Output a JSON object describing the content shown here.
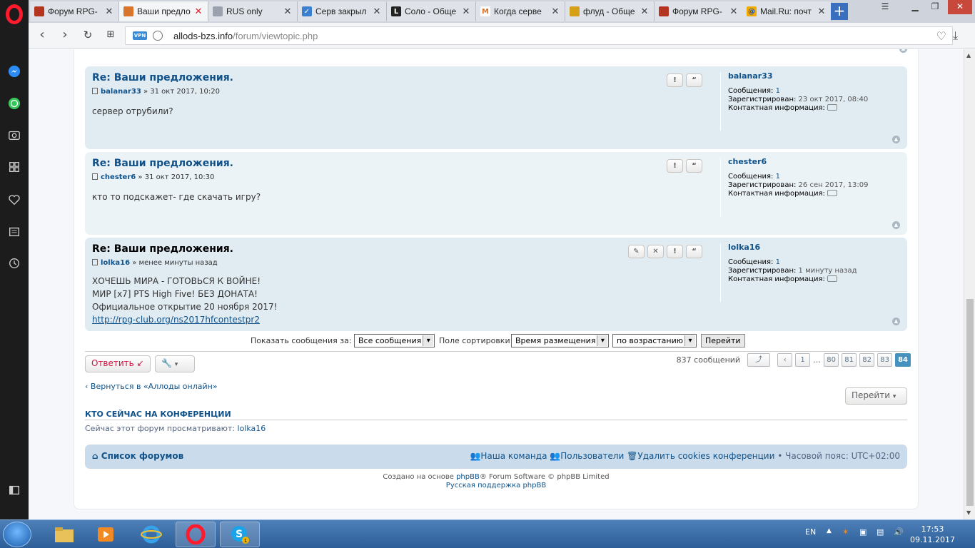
{
  "browser": {
    "tabs": [
      {
        "title": "Форум RPG-",
        "favicon_color": "#b5341f"
      },
      {
        "title": "Ваши предло",
        "favicon_color": "#d8742c",
        "active": true
      },
      {
        "title": "RUS only",
        "favicon_color": "#9aa3ad"
      },
      {
        "title": "Серв закрыл",
        "favicon_color": "#3a7fd0"
      },
      {
        "title": "Соло - Обще",
        "favicon_color": "#222222",
        "favicon_letter": "L"
      },
      {
        "title": "Когда серве",
        "favicon_color": "#d8742c",
        "favicon_letter": "M"
      },
      {
        "title": "флуд - Обще",
        "favicon_color": "#d4a018"
      },
      {
        "title": "Форум RPG-",
        "favicon_color": "#b5341f"
      },
      {
        "title": "Mail.Ru: почт",
        "favicon_color": "#f2a900",
        "favicon_letter": "@"
      }
    ],
    "vpn_label": "VPN",
    "url_host": "allods-bzs.info",
    "url_path": "/forum/viewtopic.php"
  },
  "posts": [
    {
      "title": "Re: Ваши предложения.",
      "author": "balanar33",
      "date": "» 31 окт 2017, 10:20",
      "body": [
        "сервер отрубили?"
      ],
      "profile": {
        "name": "balanar33",
        "messages_label": "Сообщения:",
        "messages": "1",
        "registered_label": "Зарегистрирован:",
        "registered": "23 окт 2017, 08:40",
        "contact_label": "Контактная информация:"
      }
    },
    {
      "title": "Re: Ваши предложения.",
      "author": "chester6",
      "date": "» 31 окт 2017, 10:30",
      "body": [
        "кто то подскажет- где скачать игру?"
      ],
      "profile": {
        "name": "chester6",
        "messages_label": "Сообщения:",
        "messages": "1",
        "registered_label": "Зарегистрирован:",
        "registered": "26 сен 2017, 13:09",
        "contact_label": "Контактная информация:"
      }
    },
    {
      "title": "Re: Ваши предложения.",
      "author": "lolka16",
      "date": "» менее минуты назад",
      "body": [
        "ХОЧЕШЬ МИРА - ГОТОВЬСЯ К ВОЙНЕ!",
        "МИР [x7] PTS High Five! БЕЗ ДОНАТА!",
        "Официальное открытие 20 ноября 2017!"
      ],
      "link": "http://rpg-club.org/ns2017hfcontestpr2",
      "profile": {
        "name": "lolka16",
        "messages_label": "Сообщения:",
        "messages": "1",
        "registered_label": "Зарегистрирован:",
        "registered": "1 минуту назад",
        "contact_label": "Контактная информация:"
      }
    }
  ],
  "sort": {
    "show_label": "Показать сообщения за:",
    "show_value": "Все сообщения",
    "sort_label": "Поле сортировки",
    "sort_value": "Время размещения",
    "order_value": "по возрастанию",
    "go": "Перейти"
  },
  "actions": {
    "reply": "Ответить"
  },
  "pagination": {
    "count": "837 сообщений",
    "pages": [
      "1",
      "…",
      "80",
      "81",
      "82",
      "83",
      "84"
    ],
    "current": "84"
  },
  "back_link": "Вернуться в «Аллоды онлайн»",
  "jump": "Перейти",
  "online": {
    "heading": "КТО СЕЙЧАС НА КОНФЕРЕНЦИИ",
    "text": "Сейчас этот форум просматривают:",
    "user": "lolka16"
  },
  "footer_nav": {
    "home": "Список форумов",
    "team": "Наша команда",
    "members": "Пользователи",
    "cookies": "Удалить cookies конференции",
    "tz_label": "Часовой пояс:",
    "tz": "UTC+02:00"
  },
  "copyright": {
    "line1_prefix": "Создано на основе",
    "phpbb": "phpBB",
    "line1_suffix": "® Forum Software © phpBB Limited",
    "line2": "Русская поддержка phpBB"
  },
  "taskbar": {
    "lang": "EN",
    "time": "17:53",
    "date": "09.11.2017",
    "skype_badge": "1"
  }
}
